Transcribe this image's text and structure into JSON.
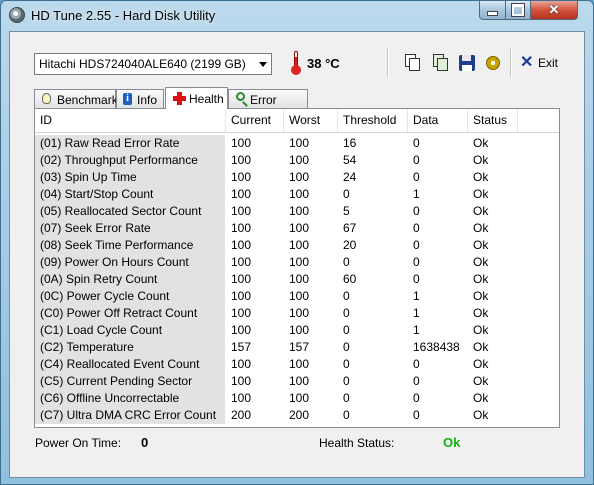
{
  "window": {
    "title": "HD Tune 2.55 - Hard Disk Utility"
  },
  "toolbar": {
    "drive": "Hitachi HDS724040ALE640 (2199 GB)",
    "temperature": "38 °C",
    "exit_label": "Exit",
    "icons": [
      "copy-text-icon",
      "copy-screenshot-icon",
      "save-icon",
      "options-icon"
    ]
  },
  "tabs": [
    {
      "label": "Benchmark",
      "icon": "benchmark-bulb-icon"
    },
    {
      "label": "Info",
      "icon": "info-icon"
    },
    {
      "label": "Health",
      "icon": "health-cross-icon",
      "active": true
    },
    {
      "label": "Error Scan",
      "icon": "magnifier-icon"
    }
  ],
  "table": {
    "headers": [
      "ID",
      "Current",
      "Worst",
      "Threshold",
      "Data",
      "Status"
    ],
    "rows": [
      [
        "(01) Raw Read Error Rate",
        "100",
        "100",
        "16",
        "0",
        "Ok"
      ],
      [
        "(02) Throughput Performance",
        "100",
        "100",
        "54",
        "0",
        "Ok"
      ],
      [
        "(03) Spin Up Time",
        "100",
        "100",
        "24",
        "0",
        "Ok"
      ],
      [
        "(04) Start/Stop Count",
        "100",
        "100",
        "0",
        "1",
        "Ok"
      ],
      [
        "(05) Reallocated Sector Count",
        "100",
        "100",
        "5",
        "0",
        "Ok"
      ],
      [
        "(07) Seek Error Rate",
        "100",
        "100",
        "67",
        "0",
        "Ok"
      ],
      [
        "(08) Seek Time Performance",
        "100",
        "100",
        "20",
        "0",
        "Ok"
      ],
      [
        "(09) Power On Hours Count",
        "100",
        "100",
        "0",
        "0",
        "Ok"
      ],
      [
        "(0A) Spin Retry Count",
        "100",
        "100",
        "60",
        "0",
        "Ok"
      ],
      [
        "(0C) Power Cycle Count",
        "100",
        "100",
        "0",
        "1",
        "Ok"
      ],
      [
        "(C0) Power Off Retract Count",
        "100",
        "100",
        "0",
        "1",
        "Ok"
      ],
      [
        "(C1) Load Cycle Count",
        "100",
        "100",
        "0",
        "1",
        "Ok"
      ],
      [
        "(C2) Temperature",
        "157",
        "157",
        "0",
        "1638438",
        "Ok"
      ],
      [
        "(C4) Reallocated Event Count",
        "100",
        "100",
        "0",
        "0",
        "Ok"
      ],
      [
        "(C5) Current Pending Sector",
        "100",
        "100",
        "0",
        "0",
        "Ok"
      ],
      [
        "(C6) Offline Uncorrectable",
        "100",
        "100",
        "0",
        "0",
        "Ok"
      ],
      [
        "(C7) Ultra DMA CRC Error Count",
        "200",
        "200",
        "0",
        "0",
        "Ok"
      ]
    ]
  },
  "footer": {
    "power_on_label": "Power On Time:",
    "power_on_value": "0",
    "health_label": "Health Status:",
    "health_value": "Ok"
  },
  "colors": {
    "health_ok": "#11b211",
    "id_column_bg": "#e2e2e2"
  }
}
